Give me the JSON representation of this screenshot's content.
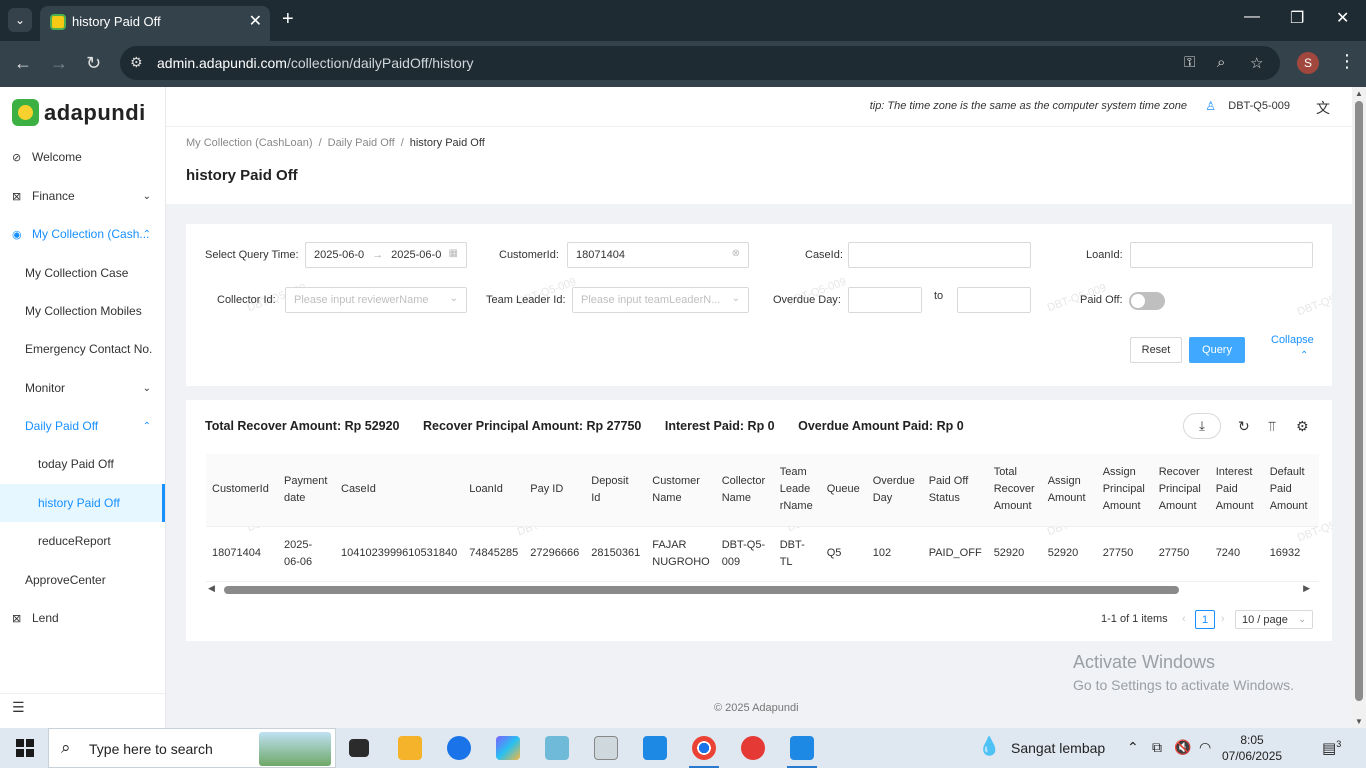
{
  "browser": {
    "tab_title": "history Paid Off",
    "url_domain": "admin.adapundi.com",
    "url_path": "/collection/dailyPaidOff/history",
    "profile_initial": "S"
  },
  "sidebar": {
    "logo": "adapundi",
    "items": [
      {
        "label": "Welcome"
      },
      {
        "label": "Finance"
      },
      {
        "label": "My Collection (Cash..."
      },
      {
        "label": "My Collection Case"
      },
      {
        "label": "My Collection Mobiles"
      },
      {
        "label": "Emergency Contact No."
      },
      {
        "label": "Monitor"
      },
      {
        "label": "Daily Paid Off"
      },
      {
        "label": "today Paid Off"
      },
      {
        "label": "history Paid Off"
      },
      {
        "label": "reduceReport"
      },
      {
        "label": "ApproveCenter"
      },
      {
        "label": "Lend"
      }
    ]
  },
  "header": {
    "tip": "tip: The time zone is the same as the computer system time zone",
    "user": "DBT-Q5-009"
  },
  "breadcrumb": [
    "My Collection (CashLoan)",
    "Daily Paid Off",
    "history Paid Off"
  ],
  "page_title": "history Paid Off",
  "filters": {
    "query_time_label": "Select Query Time",
    "query_time_start": "2025-06-0",
    "query_time_end": "2025-06-0",
    "customer_id_label": "CustomerId",
    "customer_id_value": "18071404",
    "case_id_label": "CaseId",
    "loan_id_label": "LoanId",
    "collector_id_label": "Collector Id",
    "collector_id_placeholder": "Please input reviewerName",
    "team_leader_label": "Team Leader Id",
    "team_leader_placeholder": "Please input teamLeaderN...",
    "overdue_day_label": "Overdue Day",
    "overdue_to": "to",
    "paid_off_label": "Paid Off",
    "reset": "Reset",
    "query": "Query",
    "collapse": "Collapse"
  },
  "watermark": "DBT-Q5-009",
  "summary": {
    "total_recover_label": "Total Recover Amount:",
    "total_recover_value": "Rp 52920",
    "recover_principal_label": "Recover Principal Amount:",
    "recover_principal_value": "Rp 27750",
    "interest_paid_label": "Interest Paid:",
    "interest_paid_value": "Rp 0",
    "overdue_paid_label": "Overdue Amount Paid:",
    "overdue_paid_value": "Rp 0"
  },
  "table": {
    "columns": [
      [
        "CustomerId"
      ],
      [
        "Payment",
        "date"
      ],
      [
        "CaseId"
      ],
      [
        "LoanId"
      ],
      [
        "Pay ID"
      ],
      [
        "Deposit",
        "Id"
      ],
      [
        "Customer",
        "Name"
      ],
      [
        "Collector",
        "Name"
      ],
      [
        "Team",
        "Leade",
        "rName"
      ],
      [
        "Queue"
      ],
      [
        "Overdue",
        "Day"
      ],
      [
        "Paid Off",
        "Status"
      ],
      [
        "Total",
        "Recover",
        "Amount"
      ],
      [
        "Assign",
        "Amount"
      ],
      [
        "Assign",
        "Principal",
        "Amount"
      ],
      [
        "Recover",
        "Principal",
        "Amount"
      ],
      [
        "Interest",
        "Paid",
        "Amount"
      ],
      [
        "Default",
        "Paid",
        "Amount"
      ]
    ],
    "rows": [
      [
        [
          "18071404"
        ],
        [
          "2025-",
          "06-06"
        ],
        [
          "1041023999610531840"
        ],
        [
          "74845285"
        ],
        [
          "27296666"
        ],
        [
          "28150361"
        ],
        [
          "FAJAR",
          "NUGROHO"
        ],
        [
          "DBT-Q5-",
          "009"
        ],
        [
          "DBT-",
          "TL"
        ],
        [
          "Q5"
        ],
        [
          "102"
        ],
        [
          "PAID_OFF"
        ],
        [
          "52920"
        ],
        [
          "52920"
        ],
        [
          "27750"
        ],
        [
          "27750"
        ],
        [
          "7240"
        ],
        [
          "16932"
        ]
      ]
    ]
  },
  "pagination": {
    "total": "1-1 of 1 items",
    "page": "1",
    "page_size": "10 / page"
  },
  "activate": {
    "line1": "Activate Windows",
    "line2": "Go to Settings to activate Windows."
  },
  "copyright": "© 2025 Adapundi",
  "taskbar": {
    "search_placeholder": "Type here to search",
    "weather": "Sangat lembap",
    "time": "8:05",
    "date": "07/06/2025",
    "notifications": "3"
  }
}
